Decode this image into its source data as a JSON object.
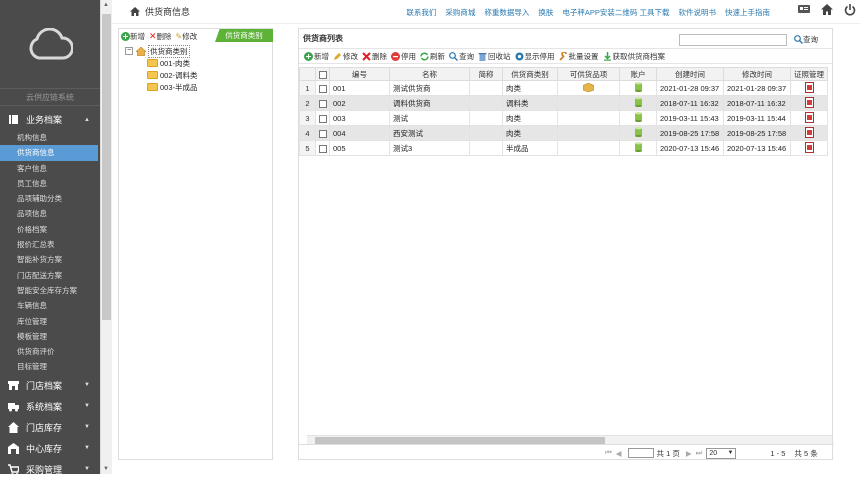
{
  "sidebar": {
    "slogan": "云供应链系统",
    "active_group": "业务档案",
    "groups_top": [
      {
        "label": "业务档案",
        "icon": "book-icon"
      }
    ],
    "items": [
      "机构信息",
      "供货商信息",
      "客户信息",
      "员工信息",
      "品项辅助分类",
      "品项信息",
      "价格档案",
      "报价汇总表",
      "智能补货方案",
      "门店配送方案",
      "智能安全库存方案",
      "车辆信息",
      "库位管理",
      "模板管理",
      "供货商评价",
      "目标管理"
    ],
    "active_item": "供货商信息",
    "groups_bottom": [
      {
        "label": "门店档案",
        "icon": "store-icon"
      },
      {
        "label": "系统档案",
        "icon": "truck-icon"
      },
      {
        "label": "门店库存",
        "icon": "house-icon"
      },
      {
        "label": "中心库存",
        "icon": "warehouse-icon"
      },
      {
        "label": "采购管理",
        "icon": "cart-icon"
      }
    ]
  },
  "header": {
    "page_title": "供货商信息",
    "links": [
      "联系我们",
      "采购商城",
      "称重数据导入",
      "换肤",
      "电子秤APP安装二维码 工具下载",
      "软件说明书",
      "快速上手指南"
    ]
  },
  "left_panel": {
    "buttons": [
      "新增",
      "删除",
      "修改"
    ],
    "tab": "供货商类别",
    "tree_root": "供货商类别",
    "tree_items": [
      "001-肉类",
      "002-调料类",
      "003-半成品"
    ]
  },
  "right_panel": {
    "title": "供货商列表",
    "search_placeholder": "",
    "search_label": "查询",
    "toolbar": [
      "新增",
      "修改",
      "删除",
      "停用",
      "刷新",
      "查询",
      "回收站",
      "显示停用",
      "批量设置",
      "获取供货商档案"
    ],
    "columns": [
      "编号",
      "名称",
      "简称",
      "供货商类别",
      "可供货品项",
      "账户",
      "创建时间",
      "修改时间",
      "证照管理"
    ],
    "rows": [
      {
        "n": "1",
        "code": "001",
        "name": "测试供货商",
        "short": "",
        "cat": "肉类",
        "has_items": true,
        "created": "2021-01-28 09:37",
        "modified": "2021-01-28 09:37"
      },
      {
        "n": "2",
        "code": "002",
        "name": "调料供货商",
        "short": "",
        "cat": "调料类",
        "has_items": false,
        "created": "2018-07-11 16:32",
        "modified": "2018-07-11 16:32"
      },
      {
        "n": "3",
        "code": "003",
        "name": "测试",
        "short": "",
        "cat": "肉类",
        "has_items": false,
        "created": "2019-03-11 15:43",
        "modified": "2019-03-11 15:44"
      },
      {
        "n": "4",
        "code": "004",
        "name": "西安测试",
        "short": "",
        "cat": "肉类",
        "has_items": false,
        "created": "2019-08-25 17:58",
        "modified": "2019-08-25 17:58"
      },
      {
        "n": "5",
        "code": "005",
        "name": "测试3",
        "short": "",
        "cat": "半成品",
        "has_items": false,
        "created": "2020-07-13 15:46",
        "modified": "2020-07-13 15:46"
      }
    ],
    "pager": {
      "page_label": "共 1 页",
      "page_size": "20",
      "range": "1 - 5",
      "total": "共 5 条"
    }
  }
}
